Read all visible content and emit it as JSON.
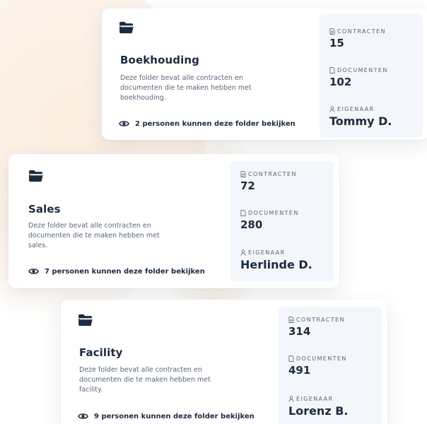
{
  "folders": [
    {
      "title": "Boekhouding",
      "description": "Deze folder bevat alle contracten en documenten die te maken hebben met boekhouding.",
      "viewers": "2 personen kunnen deze folder bekijken",
      "contracts_label": "CONTRACTEN",
      "contracts": "15",
      "documents_label": "DOCUMENTEN",
      "documents": "102",
      "owner_label": "EIGENAAR",
      "owner": "Tommy D."
    },
    {
      "title": "Sales",
      "description": "Deze folder bevat alle contracten en documenten die te maken hebben met sales.",
      "viewers": "7 personen kunnen deze folder bekijken",
      "contracts_label": "CONTRACTEN",
      "contracts": "72",
      "documents_label": "DOCUMENTEN",
      "documents": "280",
      "owner_label": "EIGENAAR",
      "owner": "Herlinde D."
    },
    {
      "title": "Facility",
      "description": "Deze folder bevat alle contracten en documenten die te maken hebben met facility.",
      "viewers": "9 personen kunnen deze folder bekijken",
      "contracts_label": "CONTRACTEN",
      "contracts": "314",
      "documents_label": "DOCUMENTEN",
      "documents": "491",
      "owner_label": "EIGENAAR",
      "owner": "Lorenz B."
    }
  ],
  "icons": {
    "folder": "folder-icon",
    "eye": "eye-icon",
    "contract": "contract-icon",
    "document": "document-icon",
    "person": "person-icon"
  },
  "colors": {
    "text_dark": "#1d2b3f",
    "text_muted": "#5b6677",
    "stats_bg": "#f3f6fa",
    "background_blob": "#fbeee0"
  }
}
